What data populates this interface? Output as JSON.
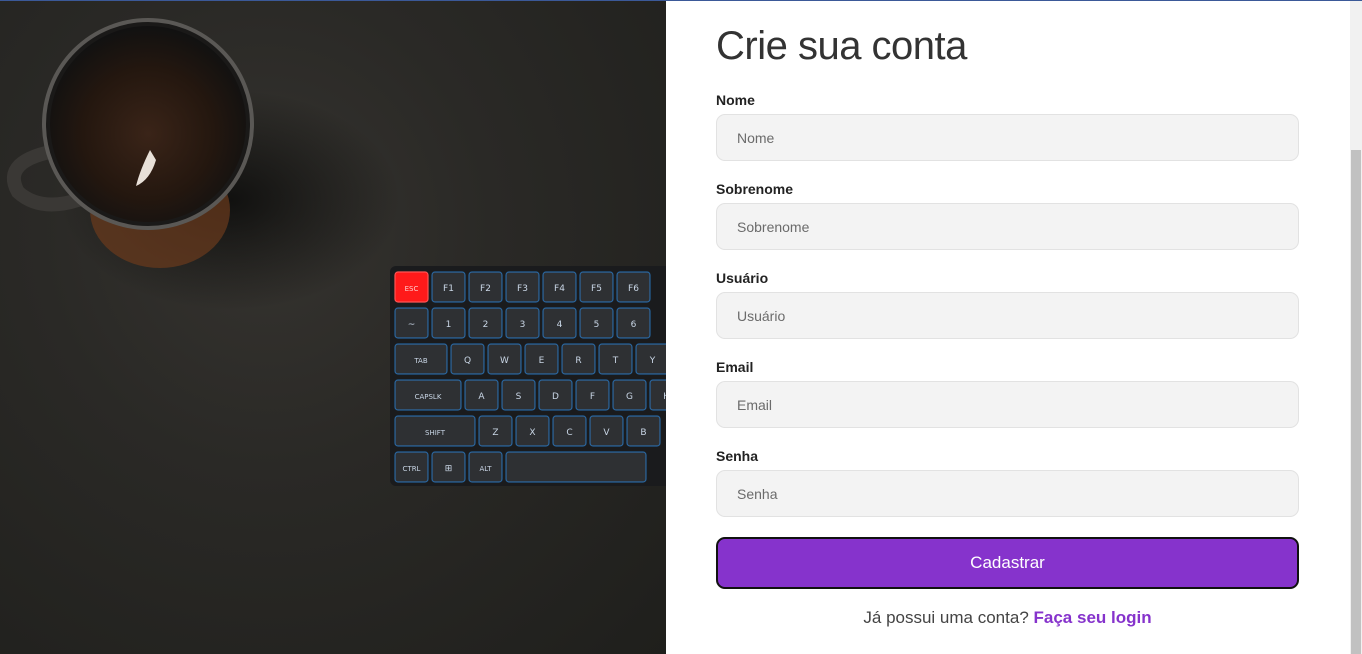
{
  "form": {
    "title": "Crie sua conta",
    "fields": [
      {
        "label": "Nome",
        "placeholder": "Nome"
      },
      {
        "label": "Sobrenome",
        "placeholder": "Sobrenome"
      },
      {
        "label": "Usuário",
        "placeholder": "Usuário"
      },
      {
        "label": "Email",
        "placeholder": "Email"
      },
      {
        "label": "Senha",
        "placeholder": "Senha"
      }
    ],
    "submit_label": "Cadastrar",
    "login_prompt": "Já possui uma conta?",
    "login_link": "Faça seu login"
  },
  "keyboard": {
    "rows": [
      [
        "ESC",
        "F1",
        "F2",
        "F3",
        "F4",
        "F5",
        "F6"
      ],
      [
        "~",
        "1",
        "2",
        "3",
        "4",
        "5",
        "6"
      ],
      [
        "TAB",
        "Q",
        "W",
        "E",
        "R",
        "T",
        "Y"
      ],
      [
        "CAPSLK",
        "A",
        "S",
        "D",
        "F",
        "G",
        "H"
      ],
      [
        "SHIFT",
        "Z",
        "X",
        "C",
        "V",
        "B"
      ],
      [
        "CTRL",
        "⊞",
        "ALT",
        ""
      ]
    ]
  },
  "colors": {
    "accent": "#8633cc",
    "input_bg": "#f3f3f3",
    "esc_key": "#ff1a1a",
    "key_glow": "#2f9bff"
  }
}
